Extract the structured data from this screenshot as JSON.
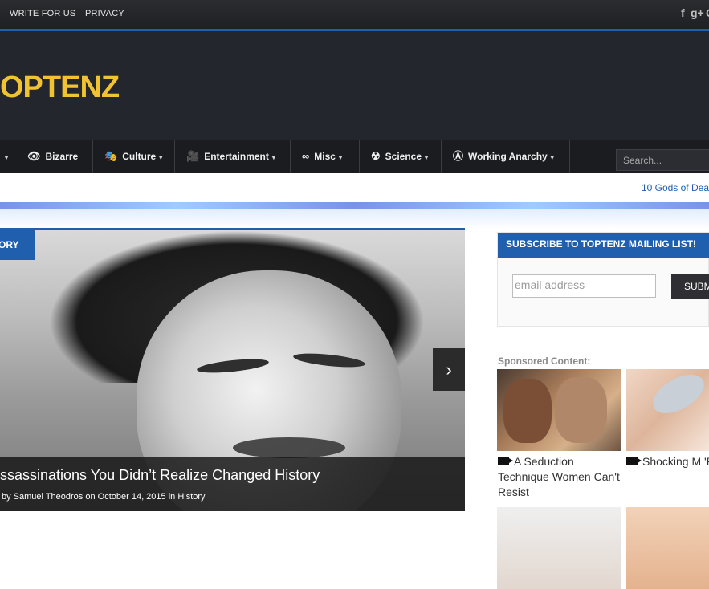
{
  "topbar": {
    "links": [
      "WRITE FOR US",
      "PRIVACY"
    ],
    "social": [
      {
        "icon": "facebook-icon",
        "glyph": "f"
      },
      {
        "icon": "google-plus-icon",
        "glyph": "g+"
      },
      {
        "icon": "rss-icon",
        "glyph": "G"
      }
    ]
  },
  "header": {
    "logo_text": "OPTENZ"
  },
  "nav": {
    "items": [
      {
        "label": "",
        "icon": "partial-menu-icon",
        "glyph": ""
      },
      {
        "label": "Bizarre",
        "icon": "eye-icon",
        "glyph": "👁"
      },
      {
        "label": "Culture",
        "icon": "theater-masks-icon",
        "glyph": "🎭"
      },
      {
        "label": "Entertainment",
        "icon": "camera-icon",
        "glyph": "🎥"
      },
      {
        "label": "Misc",
        "icon": "infinity-icon",
        "glyph": "∞"
      },
      {
        "label": "Science",
        "icon": "radiation-icon",
        "glyph": "☢"
      },
      {
        "label": "Working Anarchy",
        "icon": "anarchy-icon",
        "glyph": "Ⓐ"
      }
    ],
    "search_placeholder": "Search..."
  },
  "ticker": {
    "text": "10 Gods of Dea"
  },
  "slider": {
    "category": "ORY",
    "title": "ssassinations You Didn’t Realize Changed History",
    "meta": "by Samuel Theodros on October 14, 2015 in History",
    "next_glyph": "›"
  },
  "widget": {
    "title": "SUBSCRIBE TO TOPTENZ MAILING LIST!",
    "email_placeholder": "email address",
    "submit_label": "SUBMI"
  },
  "sponsored": {
    "label": "Sponsored Content:",
    "items": [
      {
        "title": "A Seduction Technique Women Can't Resist"
      },
      {
        "title": "Shocking M 'Restores' Lost"
      }
    ]
  }
}
